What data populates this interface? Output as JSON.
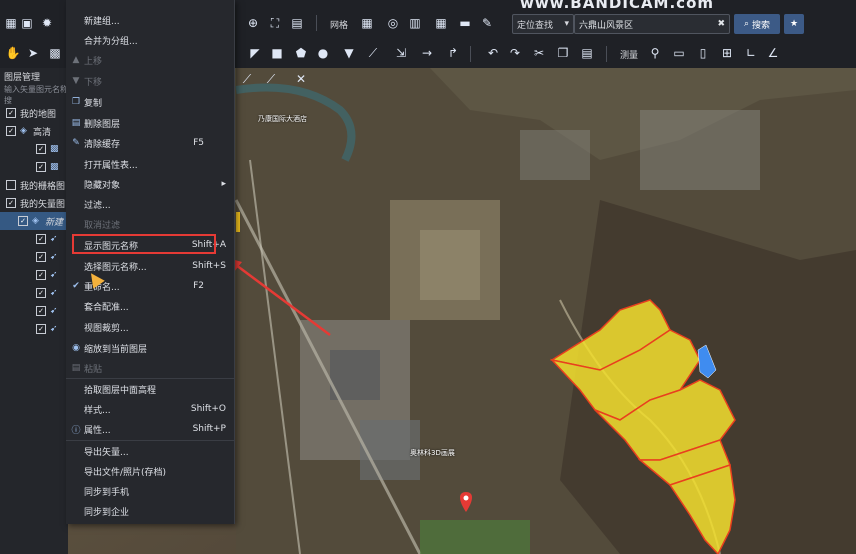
{
  "toolbar": {
    "grid_label": "网格",
    "measure_label": "测量",
    "locate_select": "定位查找",
    "search_value": "六鼎山风景区",
    "search_button": "搜索",
    "watermark": "www.BANDICAM.com"
  },
  "left_panel": {
    "title": "图层管理",
    "search_placeholder": "输入矢量图元名称搜",
    "tree": [
      {
        "label": "我的地图",
        "checked": true
      },
      {
        "label": "高清",
        "checked": true
      },
      {
        "label": "",
        "checked": true
      },
      {
        "label": "",
        "checked": true
      },
      {
        "label": "我的栅格图",
        "checked": false
      },
      {
        "label": "我的矢量图",
        "checked": true
      },
      {
        "label": "新建",
        "checked": true
      },
      {
        "label": "",
        "checked": true
      },
      {
        "label": "",
        "checked": true
      },
      {
        "label": "",
        "checked": true
      },
      {
        "label": "",
        "checked": true
      },
      {
        "label": "",
        "checked": true
      },
      {
        "label": "",
        "checked": true
      }
    ]
  },
  "context_menu": {
    "items": [
      {
        "label": "新建组...",
        "shortcut": "",
        "disabled": false,
        "icon": ""
      },
      {
        "label": "合并为分组...",
        "shortcut": "",
        "disabled": false,
        "icon": ""
      },
      {
        "label": "上移",
        "shortcut": "",
        "disabled": true,
        "icon": "arrow-up-icon"
      },
      {
        "label": "下移",
        "shortcut": "",
        "disabled": true,
        "icon": "arrow-down-icon"
      },
      {
        "label": "复制",
        "shortcut": "",
        "disabled": false,
        "icon": "copy-icon"
      },
      {
        "label": "删除图层",
        "shortcut": "",
        "disabled": false,
        "icon": "delete-icon"
      },
      {
        "label": "清除缓存",
        "shortcut": "F5",
        "disabled": false,
        "icon": "brush-icon"
      },
      {
        "label": "打开属性表...",
        "shortcut": "",
        "disabled": false,
        "icon": ""
      },
      {
        "label": "隐藏对象",
        "shortcut": "▸",
        "disabled": false,
        "icon": ""
      },
      {
        "label": "过滤...",
        "shortcut": "",
        "disabled": false,
        "icon": ""
      },
      {
        "label": "取消过滤",
        "shortcut": "",
        "disabled": true,
        "icon": ""
      },
      {
        "label": "显示图元名称",
        "shortcut": "Shift+A",
        "disabled": false,
        "icon": ""
      },
      {
        "label": "选择图元名称...",
        "shortcut": "Shift+S",
        "disabled": false,
        "icon": ""
      },
      {
        "label": "重命名...",
        "shortcut": "F2",
        "disabled": false,
        "icon": "check-icon"
      },
      {
        "label": "套合配准...",
        "shortcut": "",
        "disabled": false,
        "icon": ""
      },
      {
        "label": "视图裁剪...",
        "shortcut": "",
        "disabled": false,
        "icon": ""
      },
      {
        "label": "缩放到当前图层",
        "shortcut": "",
        "disabled": false,
        "icon": "user-icon"
      },
      {
        "label": "粘贴",
        "shortcut": "",
        "disabled": true,
        "icon": "paste-icon"
      },
      {
        "label": "拾取图层中面高程",
        "shortcut": "",
        "disabled": false,
        "icon": ""
      },
      {
        "label": "样式...",
        "shortcut": "Shift+O",
        "disabled": false,
        "icon": ""
      },
      {
        "label": "属性...",
        "shortcut": "Shift+P",
        "disabled": false,
        "icon": "info-icon"
      },
      {
        "label": "导出矢量...",
        "shortcut": "",
        "disabled": false,
        "icon": ""
      },
      {
        "label": "导出文件/照片(存档)",
        "shortcut": "",
        "disabled": false,
        "icon": ""
      },
      {
        "label": "同步到手机",
        "shortcut": "",
        "disabled": false,
        "icon": ""
      },
      {
        "label": "同步到企业",
        "shortcut": "",
        "disabled": false,
        "icon": ""
      }
    ]
  },
  "map": {
    "labels": [
      "乃康国际大酒店",
      "奥林科3D画展"
    ]
  },
  "colors": {
    "accent": "#3c5a86",
    "highlight_box": "#e53a35",
    "polygon_fill": "#f5e12e",
    "polygon_stroke": "#e8401e"
  }
}
